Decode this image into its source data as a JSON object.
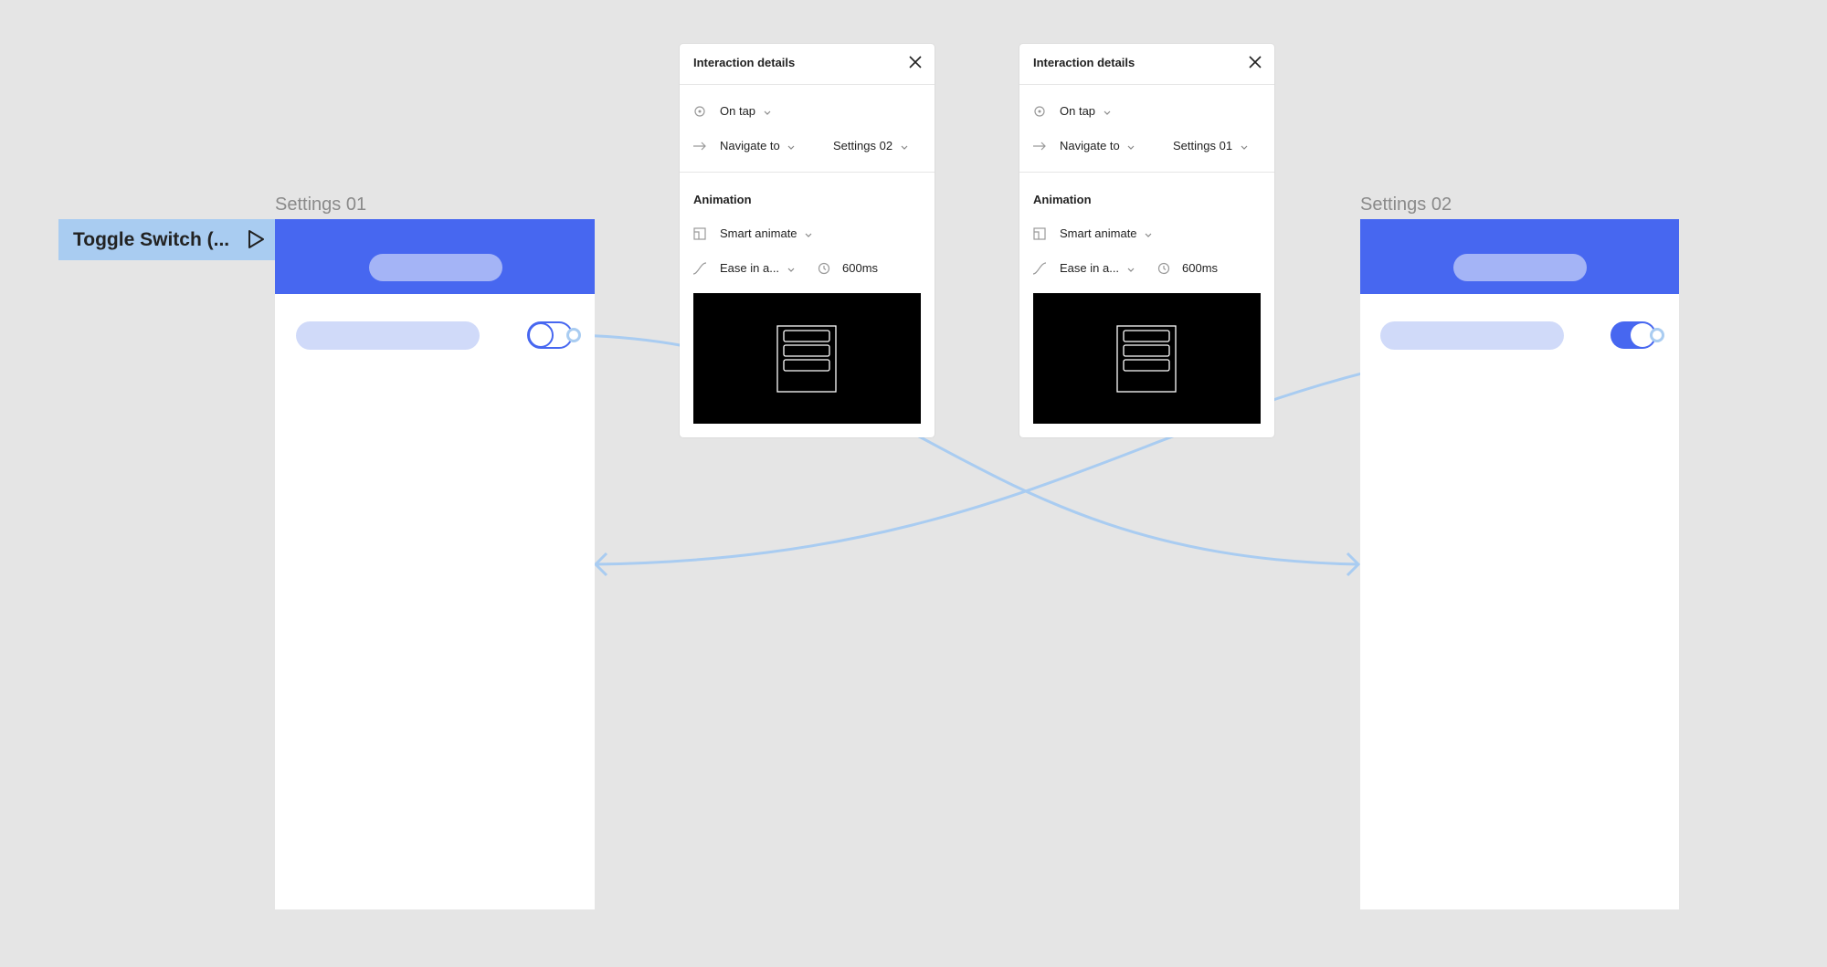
{
  "canvas": {
    "background": "#e5e5e5",
    "accent": "#4767f0",
    "connector_color": "#a9ccf1"
  },
  "component_tag": {
    "label": "Toggle Switch (...",
    "play_icon": "play-icon"
  },
  "frames": [
    {
      "label": "Settings 01",
      "toggle_state": "off"
    },
    {
      "label": "Settings 02",
      "toggle_state": "on"
    }
  ],
  "panels": [
    {
      "title": "Interaction details",
      "close_icon": "close-icon",
      "trigger": "On tap",
      "action": "Navigate to",
      "destination": "Settings 02",
      "animation_heading": "Animation",
      "animation_type": "Smart animate",
      "easing": "Ease in a...",
      "duration": "600ms"
    },
    {
      "title": "Interaction details",
      "close_icon": "close-icon",
      "trigger": "On tap",
      "action": "Navigate to",
      "destination": "Settings 01",
      "animation_heading": "Animation",
      "animation_type": "Smart animate",
      "easing": "Ease in a...",
      "duration": "600ms"
    }
  ]
}
